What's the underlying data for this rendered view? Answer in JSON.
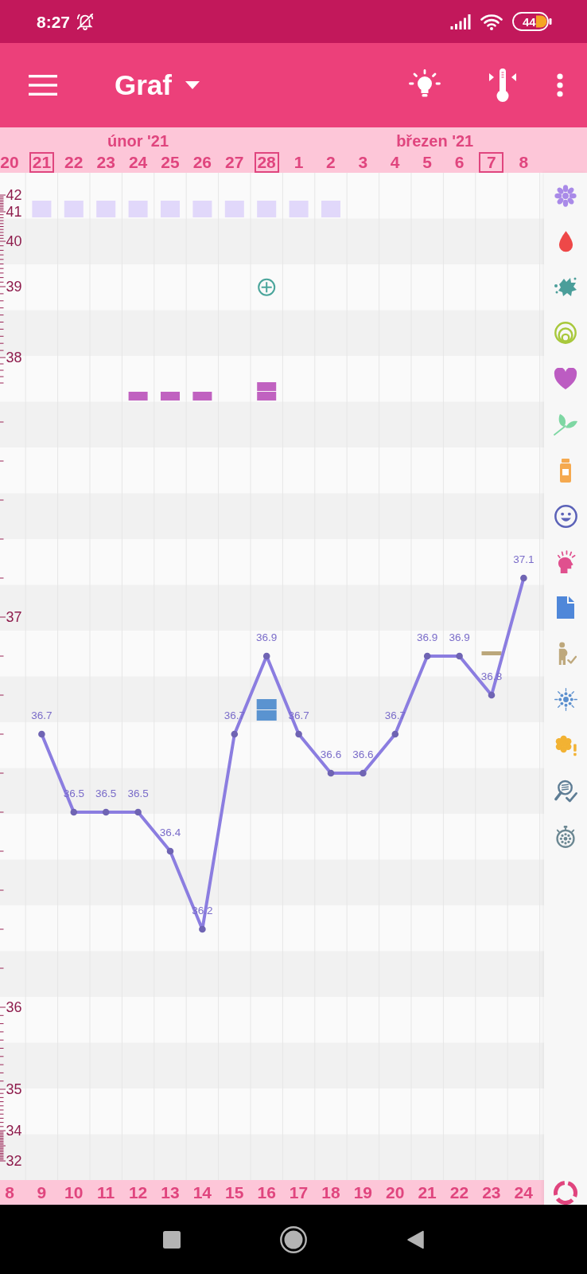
{
  "status_bar": {
    "time": "8:27",
    "battery": "44"
  },
  "app_bar": {
    "title": "Graf"
  },
  "date_header": {
    "months": [
      {
        "label": "únor '21",
        "days": [
          {
            "date": "20",
            "boxed": false
          },
          {
            "date": "21",
            "boxed": true,
            "marks": [
              {
                "kind": "flower"
              }
            ]
          },
          {
            "date": "22",
            "boxed": false,
            "marks": [
              {
                "kind": "flower"
              }
            ]
          },
          {
            "date": "23",
            "boxed": false,
            "marks": [
              {
                "kind": "flower"
              }
            ]
          },
          {
            "date": "24",
            "boxed": false,
            "marks": [
              {
                "kind": "flower"
              },
              {
                "kind": "heart"
              }
            ]
          },
          {
            "date": "25",
            "boxed": false,
            "marks": [
              {
                "kind": "flower"
              },
              {
                "kind": "heart"
              }
            ]
          },
          {
            "date": "26",
            "boxed": false,
            "marks": [
              {
                "kind": "flower"
              },
              {
                "kind": "heart"
              }
            ]
          },
          {
            "date": "27",
            "boxed": false,
            "marks": [
              {
                "kind": "flower"
              }
            ]
          },
          {
            "date": "28",
            "boxed": true,
            "marks": [
              {
                "kind": "flower"
              },
              {
                "kind": "splat"
              },
              {
                "kind": "heart"
              },
              {
                "kind": "heart"
              },
              {
                "kind": "sparkle"
              },
              {
                "kind": "sparkle"
              }
            ]
          }
        ]
      },
      {
        "label": "březen '21",
        "days": [
          {
            "date": "1",
            "boxed": false,
            "marks": [
              {
                "kind": "flower"
              }
            ]
          },
          {
            "date": "2",
            "boxed": false,
            "marks": [
              {
                "kind": "flower"
              }
            ]
          },
          {
            "date": "3",
            "boxed": false
          },
          {
            "date": "4",
            "boxed": false
          },
          {
            "date": "5",
            "boxed": false
          },
          {
            "date": "6",
            "boxed": false
          },
          {
            "date": "7",
            "boxed": true,
            "marks": [
              {
                "kind": "figure"
              }
            ]
          },
          {
            "date": "8",
            "boxed": false
          }
        ]
      }
    ]
  },
  "chart": {
    "scale_labels": [
      "42",
      "41",
      "40",
      "39",
      "38",
      "37",
      "36",
      "35",
      "34",
      "32"
    ],
    "chart_data": {
      "type": "line",
      "categories": [
        "8",
        "9",
        "10",
        "11",
        "12",
        "13",
        "14",
        "15",
        "16",
        "17",
        "18",
        "19",
        "20",
        "21",
        "22",
        "23",
        "24"
      ],
      "series": [
        {
          "color": "#8b7de0",
          "marker": "circle",
          "values": [
            null,
            36.7,
            36.5,
            36.5,
            36.5,
            36.4,
            36.2,
            36.7,
            36.9,
            36.7,
            36.6,
            36.6,
            36.7,
            36.9,
            36.9,
            36.8,
            37.1
          ]
        }
      ],
      "data_labels": true,
      "value_labels": [
        null,
        "36.7",
        "36.5",
        "36.5",
        "36.5",
        "36.4",
        "36.2",
        "36.7",
        "36.9",
        "36.7",
        "36.6",
        "36.6",
        "36.7",
        "36.9",
        "36.9",
        "36.8",
        "37.1"
      ]
    }
  }
}
